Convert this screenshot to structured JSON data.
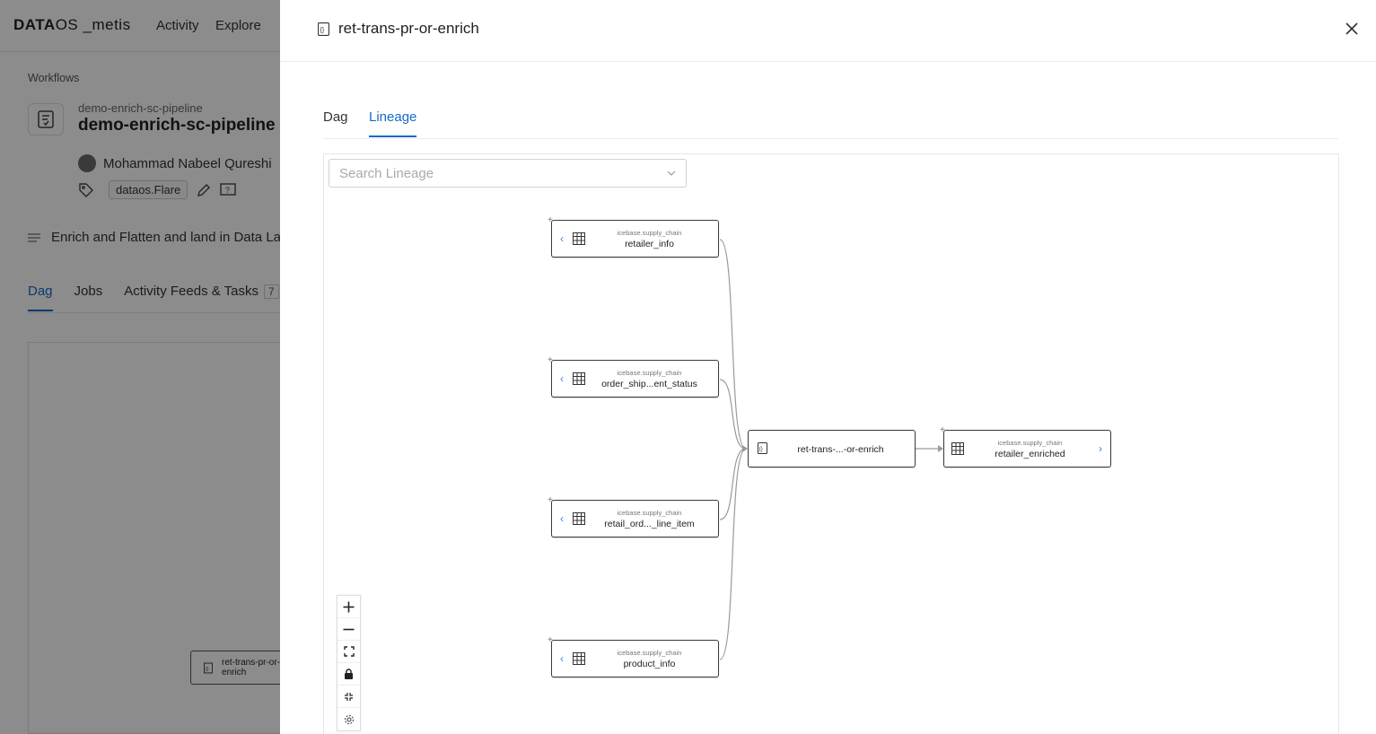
{
  "app": {
    "logo_brand": "DATA",
    "logo_brand2": "OS",
    "logo_suffix": "_metis",
    "nav": [
      "Activity",
      "Explore"
    ]
  },
  "workflow": {
    "breadcrumb": "Workflows",
    "subtitle": "demo-enrich-sc-pipeline",
    "title": "demo-enrich-sc-pipeline",
    "owner": "Mohammad Nabeel Qureshi",
    "tag": "dataos.Flare",
    "description": "Enrich and Flatten and land in Data Lake",
    "tabs": [
      "Dag",
      "Jobs",
      "Activity Feeds & Tasks"
    ],
    "tasks_count": "7",
    "bg_node_label": "ret-trans-pr-or-enrich"
  },
  "drawer": {
    "title": "ret-trans-pr-or-enrich",
    "tabs": [
      {
        "label": "Dag",
        "active": false
      },
      {
        "label": "Lineage",
        "active": true
      }
    ],
    "search_placeholder": "Search Lineage"
  },
  "lineage": {
    "inputs": [
      {
        "namespace": "icebase.supply_chain",
        "name": "retailer_info"
      },
      {
        "namespace": "icebase.supply_chain",
        "name": "order_ship...ent_status"
      },
      {
        "namespace": "icebase.supply_chain",
        "name": "retail_ord..._line_item"
      },
      {
        "namespace": "icebase.supply_chain",
        "name": "product_info"
      }
    ],
    "process": {
      "name": "ret-trans-...-or-enrich"
    },
    "output": {
      "namespace": "icebase.supply_chain",
      "name": "retailer_enriched"
    }
  },
  "controls": [
    "zoom-in",
    "zoom-out",
    "fit-view",
    "lock",
    "collapse",
    "settings"
  ],
  "colors": {
    "accent": "#1769c9",
    "expand": "#3b82d6",
    "edge": "#9a9a9a"
  }
}
